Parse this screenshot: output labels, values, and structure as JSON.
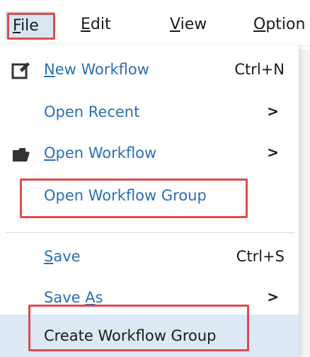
{
  "menubar": {
    "file": {
      "prefix": "",
      "mnemonic": "F",
      "rest": "ile"
    },
    "edit": {
      "mnemonic": "E",
      "rest": "dit"
    },
    "view": {
      "mnemonic": "V",
      "rest": "iew"
    },
    "options": {
      "mnemonic": "O",
      "rest": "ption"
    }
  },
  "menu": {
    "new_workflow": {
      "mnemonic": "N",
      "rest": "ew Workflow",
      "shortcut": "Ctrl+N",
      "icon": "edit-icon"
    },
    "open_recent": {
      "label": "Open Recent",
      "arrow": ">"
    },
    "open_workflow": {
      "mnemonic": "O",
      "rest": "pen Workflow",
      "arrow": ">",
      "icon": "folder-open-icon"
    },
    "open_workflow_group": {
      "label": "Open Workflow Group"
    },
    "save": {
      "mnemonic": "S",
      "rest": "ave",
      "shortcut": "Ctrl+S"
    },
    "save_as": {
      "before": "Save ",
      "mnemonic": "A",
      "rest": "s",
      "arrow": ">"
    },
    "create_workflow_group": {
      "label": "Create Workflow Group"
    }
  },
  "colors": {
    "link_blue": "#2a6fb6",
    "highlight": "#e04a4a",
    "hover": "#dce9f5"
  }
}
